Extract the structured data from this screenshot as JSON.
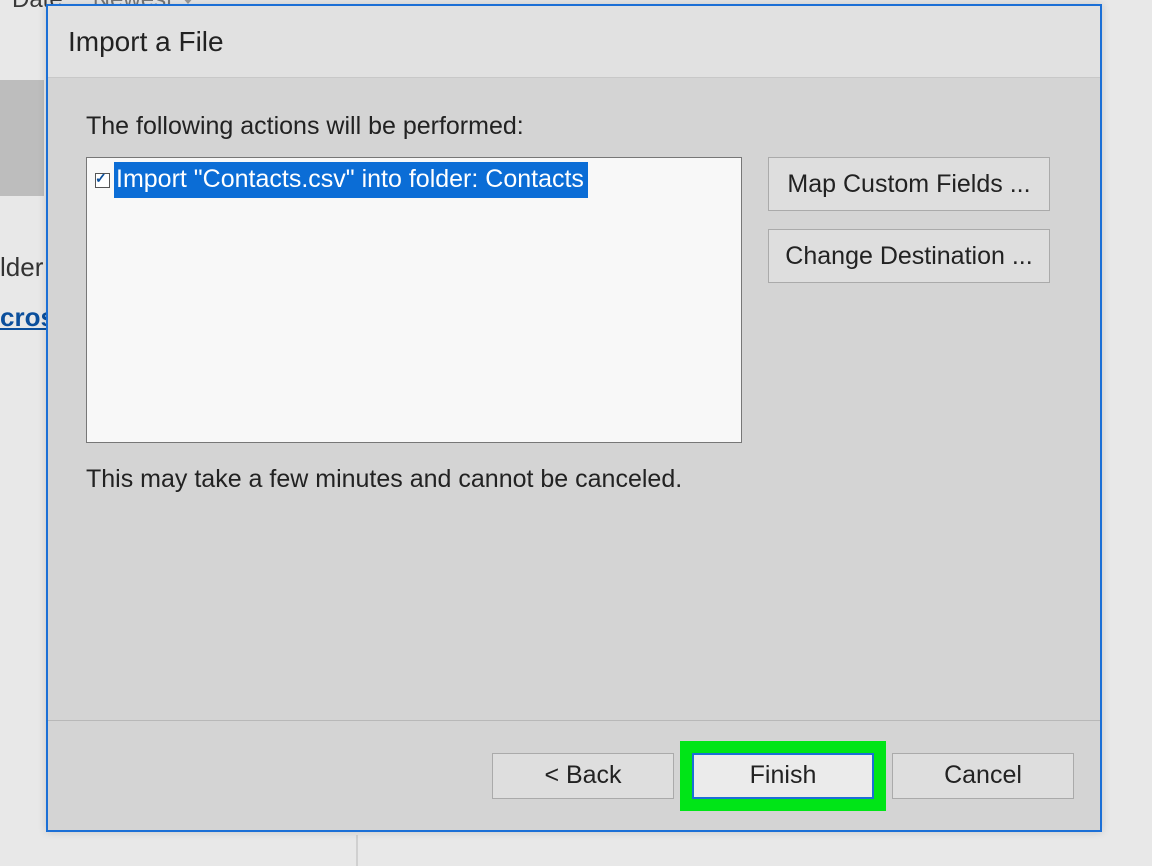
{
  "background": {
    "sort_date_label": "Date",
    "sort_newest_label": "Newest",
    "sidebar_truncated_1": "lder",
    "sidebar_truncated_2": "cros"
  },
  "dialog": {
    "title": "Import a File",
    "prompt": "The following actions will be performed:",
    "list_item": "Import \"Contacts.csv\" into folder: Contacts",
    "warning": "This may take a few minutes and cannot be canceled.",
    "buttons": {
      "map_custom_fields": "Map Custom Fields ...",
      "change_destination": "Change Destination ...",
      "back": "< Back",
      "finish": "Finish",
      "cancel": "Cancel"
    }
  }
}
